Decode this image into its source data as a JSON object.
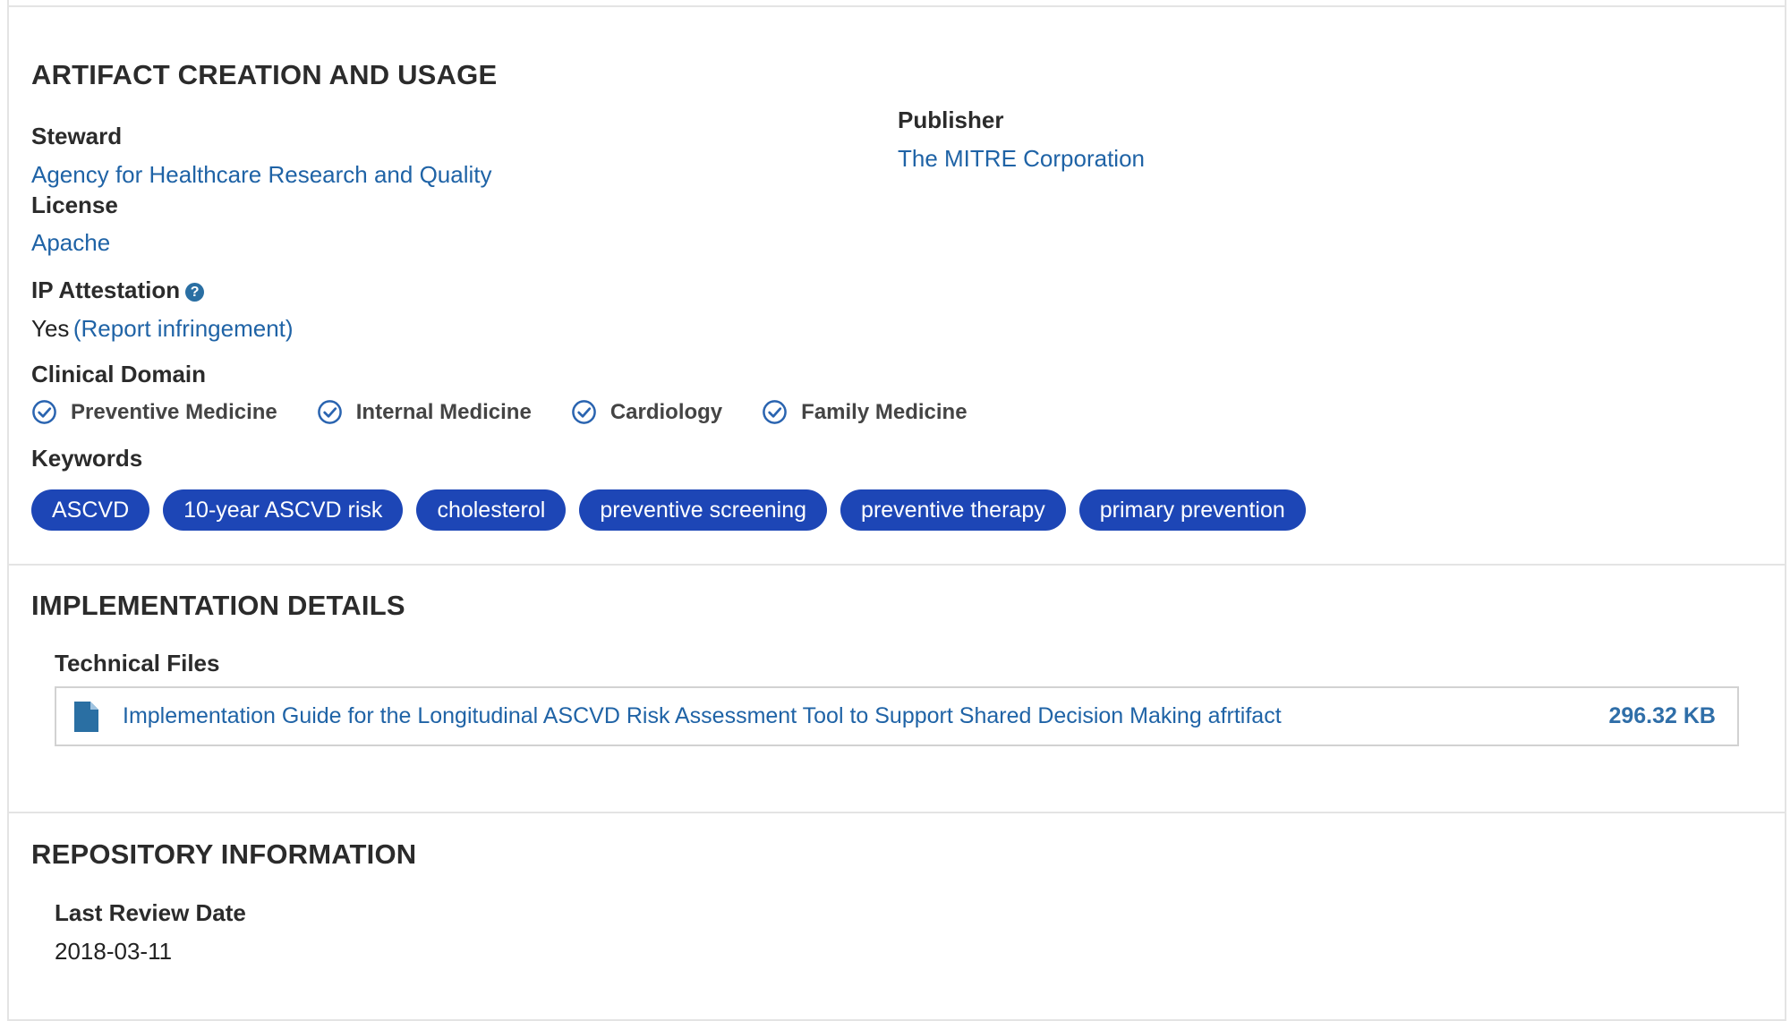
{
  "artifact_creation": {
    "title": "ARTIFACT CREATION AND USAGE",
    "steward_label": "Steward",
    "steward_value": "Agency for Healthcare Research and Quality",
    "publisher_label": "Publisher",
    "publisher_value": "The MITRE Corporation",
    "license_label": "License",
    "license_value": "Apache",
    "ip_label": "IP Attestation",
    "ip_help_icon": "?",
    "ip_value": "Yes",
    "ip_report_link": "(Report infringement)",
    "clinical_domain_label": "Clinical Domain",
    "clinical_domains": [
      "Preventive Medicine",
      "Internal Medicine",
      "Cardiology",
      "Family Medicine"
    ],
    "keywords_label": "Keywords",
    "keywords": [
      "ASCVD",
      "10-year ASCVD risk",
      "cholesterol",
      "preventive screening",
      "preventive therapy",
      "primary prevention"
    ]
  },
  "implementation": {
    "title": "IMPLEMENTATION DETAILS",
    "technical_files_label": "Technical Files",
    "file_name": "Implementation Guide for the Longitudinal ASCVD Risk Assessment Tool to Support Shared Decision Making afrtifact",
    "file_size": "296.32 KB",
    "file_icon": "document-icon"
  },
  "repository": {
    "title": "REPOSITORY INFORMATION",
    "last_review_label": "Last Review Date",
    "last_review_value": "2018-03-11"
  },
  "colors": {
    "link": "#1f63a6",
    "pill": "#1d46b6",
    "check": "#2a64b0"
  }
}
